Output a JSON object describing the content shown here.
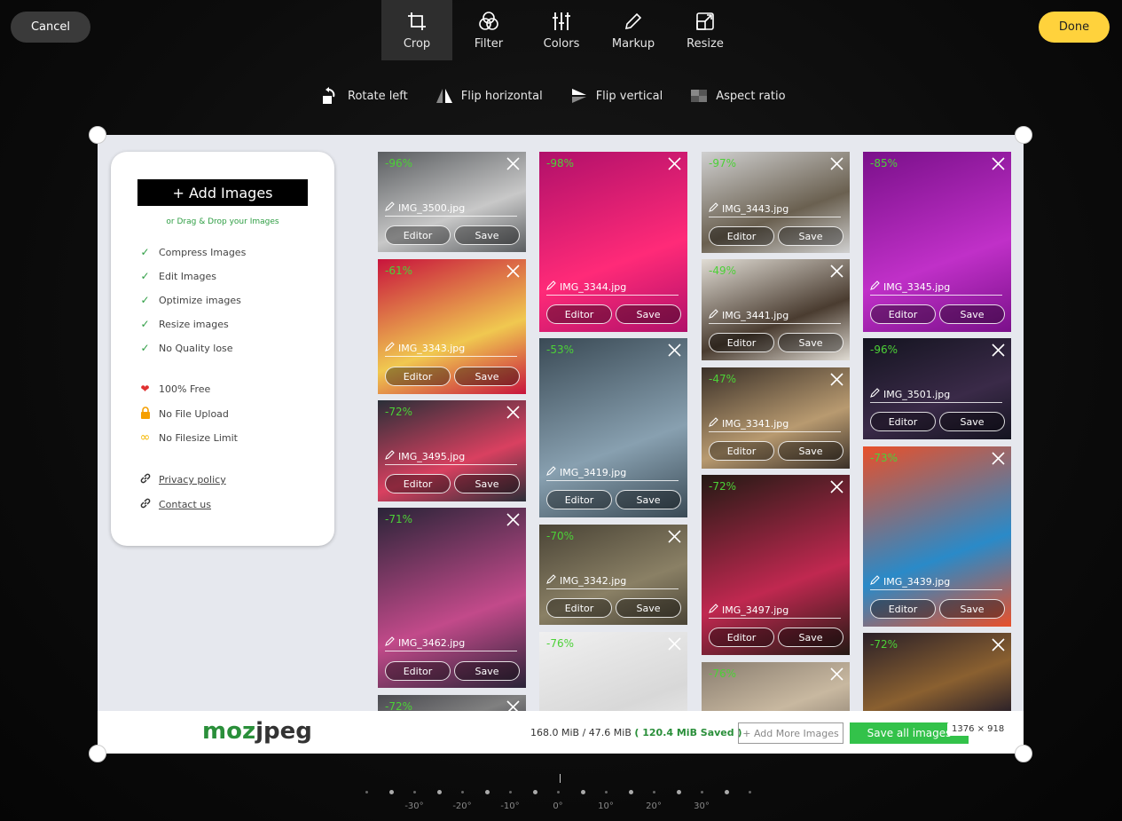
{
  "topbar": {
    "cancel_label": "Cancel",
    "done_label": "Done"
  },
  "tools": [
    {
      "label": "Crop",
      "icon": "crop-icon",
      "active": true
    },
    {
      "label": "Filter",
      "icon": "filter-icon"
    },
    {
      "label": "Colors",
      "icon": "sliders-icon"
    },
    {
      "label": "Markup",
      "icon": "pen-icon"
    },
    {
      "label": "Resize",
      "icon": "resize-icon"
    }
  ],
  "subtools": [
    {
      "label": "Rotate left",
      "icon": "rotate-left-icon"
    },
    {
      "label": "Flip horizontal",
      "icon": "flip-horizontal-icon"
    },
    {
      "label": "Flip vertical",
      "icon": "flip-vertical-icon"
    },
    {
      "label": "Aspect ratio",
      "icon": "aspect-ratio-icon"
    }
  ],
  "panel": {
    "add_label": "+ Add Images",
    "drag_text": "or Drag & Drop your Images",
    "features": [
      "Compress Images",
      "Edit Images",
      "Optimize images",
      "Resize images",
      "No Quality lose"
    ],
    "perks": [
      {
        "label": "100% Free",
        "icon": "heart-icon"
      },
      {
        "label": "No File Upload",
        "icon": "lock-icon"
      },
      {
        "label": "No Filesize Limit",
        "icon": "infinity-icon"
      }
    ],
    "links": [
      "Privacy policy",
      "Contact us"
    ]
  },
  "images": [
    {
      "pct": "-96%",
      "name": "IMG_3500.jpg"
    },
    {
      "pct": "-61%",
      "name": "IMG_3343.jpg"
    },
    {
      "pct": "-72%",
      "name": "IMG_3495.jpg"
    },
    {
      "pct": "-71%",
      "name": "IMG_3462.jpg"
    },
    {
      "pct": "-72%",
      "name": ""
    },
    {
      "pct": "-98%",
      "name": "IMG_3344.jpg"
    },
    {
      "pct": "-53%",
      "name": "IMG_3419.jpg"
    },
    {
      "pct": "-70%",
      "name": "IMG_3342.jpg"
    },
    {
      "pct": "-76%",
      "name": ""
    },
    {
      "pct": "-97%",
      "name": "IMG_3443.jpg"
    },
    {
      "pct": "-49%",
      "name": "IMG_3441.jpg"
    },
    {
      "pct": "-47%",
      "name": "IMG_3341.jpg"
    },
    {
      "pct": "-72%",
      "name": "IMG_3497.jpg"
    },
    {
      "pct": "-76%",
      "name": ""
    },
    {
      "pct": "-85%",
      "name": "IMG_3345.jpg"
    },
    {
      "pct": "-96%",
      "name": "IMG_3501.jpg"
    },
    {
      "pct": "-73%",
      "name": "IMG_3439.jpg"
    },
    {
      "pct": "-72%",
      "name": ""
    }
  ],
  "card_buttons": {
    "editor": "Editor",
    "save": "Save"
  },
  "bottom": {
    "logo_moz": "moz",
    "logo_jpeg": "jpeg",
    "stats": "168.0 MiB / 47.6 MiB",
    "saved": "( 120.4 MiB Saved )",
    "more_label": "+ Add More Images",
    "save_all_label": "Save all images",
    "dims": "1376 × 918"
  },
  "dial": {
    "labels": [
      "-30°",
      "-20°",
      "-10°",
      "0°",
      "10°",
      "20°",
      "30°"
    ]
  }
}
